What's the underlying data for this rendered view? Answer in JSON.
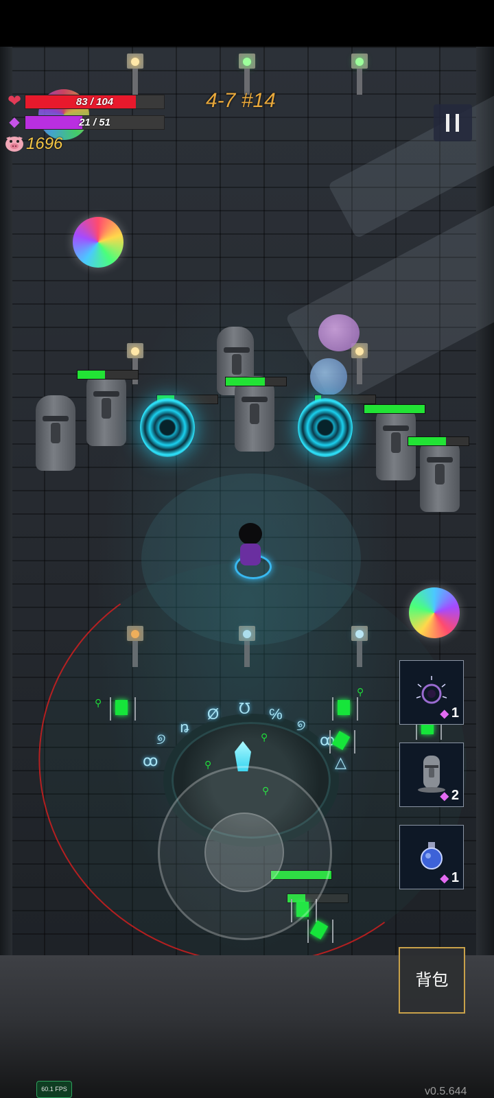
{
  "hud": {
    "hp": {
      "current": 83,
      "max": 104,
      "text": "83 / 104"
    },
    "mp": {
      "current": 21,
      "max": 51,
      "text": "21 / 51"
    },
    "coins": "1696",
    "level": "4-7 #14"
  },
  "skills": [
    {
      "icon": "portal-orb-icon",
      "cost": "1"
    },
    {
      "icon": "moai-statue-icon",
      "cost": "2"
    },
    {
      "icon": "potion-flask-icon",
      "cost": "1"
    }
  ],
  "backpack_label": "背包",
  "fps": "60.1 FPS",
  "version": "v0.5.644",
  "colors": {
    "hp": "#e8192c",
    "mp": "#b92fe0",
    "enemy_health": "#22e335",
    "gold": "#f5c644",
    "level": "#e8a83b"
  },
  "enemy_health": [
    0.85,
    0.65,
    0.75,
    1.0,
    0.9,
    0.5,
    0.8
  ]
}
